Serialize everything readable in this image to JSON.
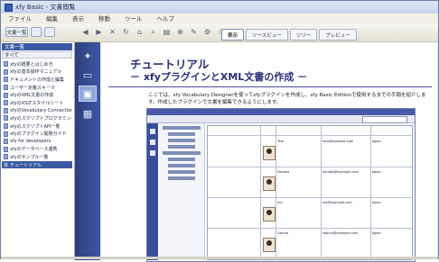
{
  "window": {
    "title": "xfy Basic - 文書閲覧"
  },
  "menu": [
    "ファイル",
    "編集",
    "表示",
    "移動",
    "ツール",
    "ヘルプ"
  ],
  "toolbar": {
    "view_selector": "文書一覧",
    "icons": [
      "back-icon",
      "forward-icon",
      "stop-icon",
      "refresh-icon",
      "home-icon",
      "search-icon",
      "print-icon",
      "zoom-icon",
      "edit-icon",
      "settings-icon",
      "bookmark-icon"
    ]
  },
  "tabs": [
    {
      "label": "表示",
      "active": true
    },
    {
      "label": "ソースビュー",
      "active": false
    },
    {
      "label": "ツリー",
      "active": false
    },
    {
      "label": "プレビュー",
      "active": false
    }
  ],
  "left_panel": {
    "header": "文書一覧",
    "filter": "すべて",
    "items": [
      {
        "label": "xfyの概要とはじめ方",
        "selected": false
      },
      {
        "label": "xfyの基本操作マニュアル",
        "selected": false
      },
      {
        "label": "ドキュメントの作成と編集",
        "selected": false
      },
      {
        "label": "ユーザー定義スキーマ",
        "selected": false
      },
      {
        "label": "xfyのXML文書の作成",
        "selected": false
      },
      {
        "label": "xfyのXSLTスタイルシート",
        "selected": false
      },
      {
        "label": "xfyのVocabulary Connection",
        "selected": false
      },
      {
        "label": "xfyのスクリプトプログラミング",
        "selected": false
      },
      {
        "label": "xfyのスクリプトAPI一覧",
        "selected": false
      },
      {
        "label": "xfyのプラグイン開発ガイド",
        "selected": false
      },
      {
        "label": "xfy for developers",
        "selected": false
      },
      {
        "label": "xfyのデータベース連携",
        "selected": false
      },
      {
        "label": "xfyのサンプル一覧",
        "selected": false
      },
      {
        "label": "チュートリアル",
        "selected": true
      }
    ]
  },
  "sidebar": [
    {
      "icon": "bookmark-icon",
      "active": false
    },
    {
      "icon": "document-icon",
      "active": false
    },
    {
      "icon": "image-icon",
      "active": true
    },
    {
      "icon": "grid-icon",
      "active": false
    }
  ],
  "content": {
    "title": "チュートリアル",
    "subtitle": "－ xfyプラグインとXML文書の作成 －",
    "paragraph": "ここでは、xfy Vocabulary Designerを使ってxfyプラグインを作成し、xfy Basic Editionで使用するまでの手順を紹介します。作成したプラグインで文書を編集できるようにします。",
    "screenshot_rows": [
      {
        "name": "Taro",
        "email": "taro@example.com",
        "note": "Japan"
      },
      {
        "name": "Hanako",
        "email": "hanako@example.com",
        "note": "Japan"
      },
      {
        "name": "Jiro",
        "email": "jiro@example.com",
        "note": "Japan"
      },
      {
        "name": "Saburo",
        "email": "saburo@example.com",
        "note": "Japan"
      }
    ]
  }
}
